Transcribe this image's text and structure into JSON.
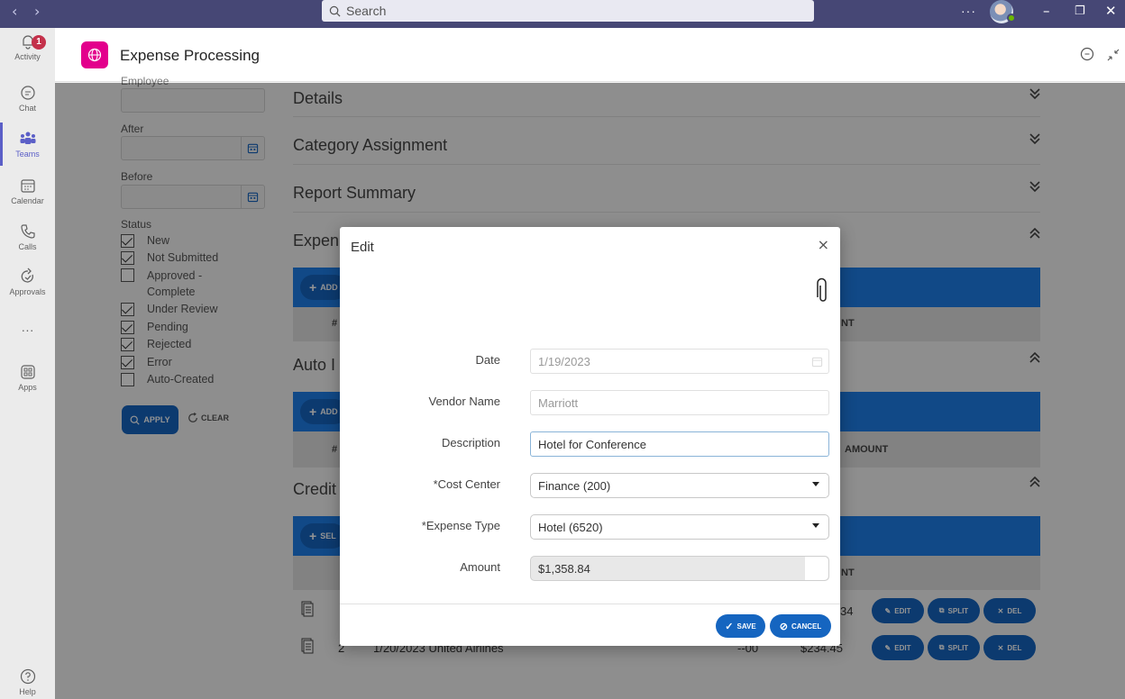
{
  "titlebar": {
    "search_placeholder": "Search",
    "more_label": "···",
    "back_icon": "chevron-left-icon",
    "forward_icon": "chevron-right-icon",
    "accent": "#464775"
  },
  "rail": {
    "items": [
      {
        "label": "Activity",
        "icon": "bell-icon",
        "badge": "1"
      },
      {
        "label": "Chat",
        "icon": "chat-icon"
      },
      {
        "label": "Teams",
        "icon": "teams-icon",
        "active": true
      },
      {
        "label": "Calendar",
        "icon": "calendar-icon"
      },
      {
        "label": "Calls",
        "icon": "phone-icon"
      },
      {
        "label": "Approvals",
        "icon": "approvals-icon"
      },
      {
        "label": "···",
        "icon": "more-icon"
      },
      {
        "label": "Apps",
        "icon": "apps-icon"
      }
    ],
    "help_label": "Help"
  },
  "app": {
    "title": "Expense Processing",
    "logo_color": "#e3008c"
  },
  "filters": {
    "employee_label": "Employee",
    "after_label": "After",
    "before_label": "Before",
    "status_label": "Status",
    "statuses": [
      {
        "label": "New",
        "checked": true
      },
      {
        "label": "Not Submitted",
        "checked": true
      },
      {
        "label": "Approved - Complete",
        "checked": false
      },
      {
        "label": "Under Review",
        "checked": true
      },
      {
        "label": "Pending",
        "checked": true
      },
      {
        "label": "Rejected",
        "checked": true
      },
      {
        "label": "Error",
        "checked": true
      },
      {
        "label": "Auto-Created",
        "checked": false
      }
    ],
    "apply_label": "APPLY",
    "clear_label": "CLEAR"
  },
  "sections": {
    "details": "Details",
    "category": "Category Assignment",
    "summary": "Report Summary",
    "expenses": "Expen",
    "auto": "Auto I",
    "credit": "Credit"
  },
  "tables": {
    "add_label": "ADD",
    "select_label": "SEL",
    "hash_col": "#",
    "nt_col": "NT",
    "amount_col": "AMOUNT"
  },
  "credit_rows": [
    {
      "num": "",
      "text": "",
      "amount_frag": "34"
    },
    {
      "num": "2",
      "text": "1/20/2023  United Airlines",
      "mid_frag": "--00",
      "amount_frag": "$234.45"
    }
  ],
  "row_actions": {
    "edit": "EDIT",
    "split": "SPLIT",
    "del": "DEL"
  },
  "modal": {
    "title": "Edit",
    "close": "×",
    "fields": {
      "date_label": "Date",
      "date_value": "1/19/2023",
      "vendor_label": "Vendor Name",
      "vendor_value": "Marriott",
      "description_label": "Description",
      "description_value": "Hotel for Conference",
      "cost_center_label": "*Cost Center",
      "cost_center_value": "Finance (200)",
      "expense_type_label": "*Expense Type",
      "expense_type_value": "Hotel (6520)",
      "amount_label": "Amount",
      "amount_value": "$1,358.84"
    },
    "save_label": "SAVE",
    "cancel_label": "CANCEL"
  }
}
